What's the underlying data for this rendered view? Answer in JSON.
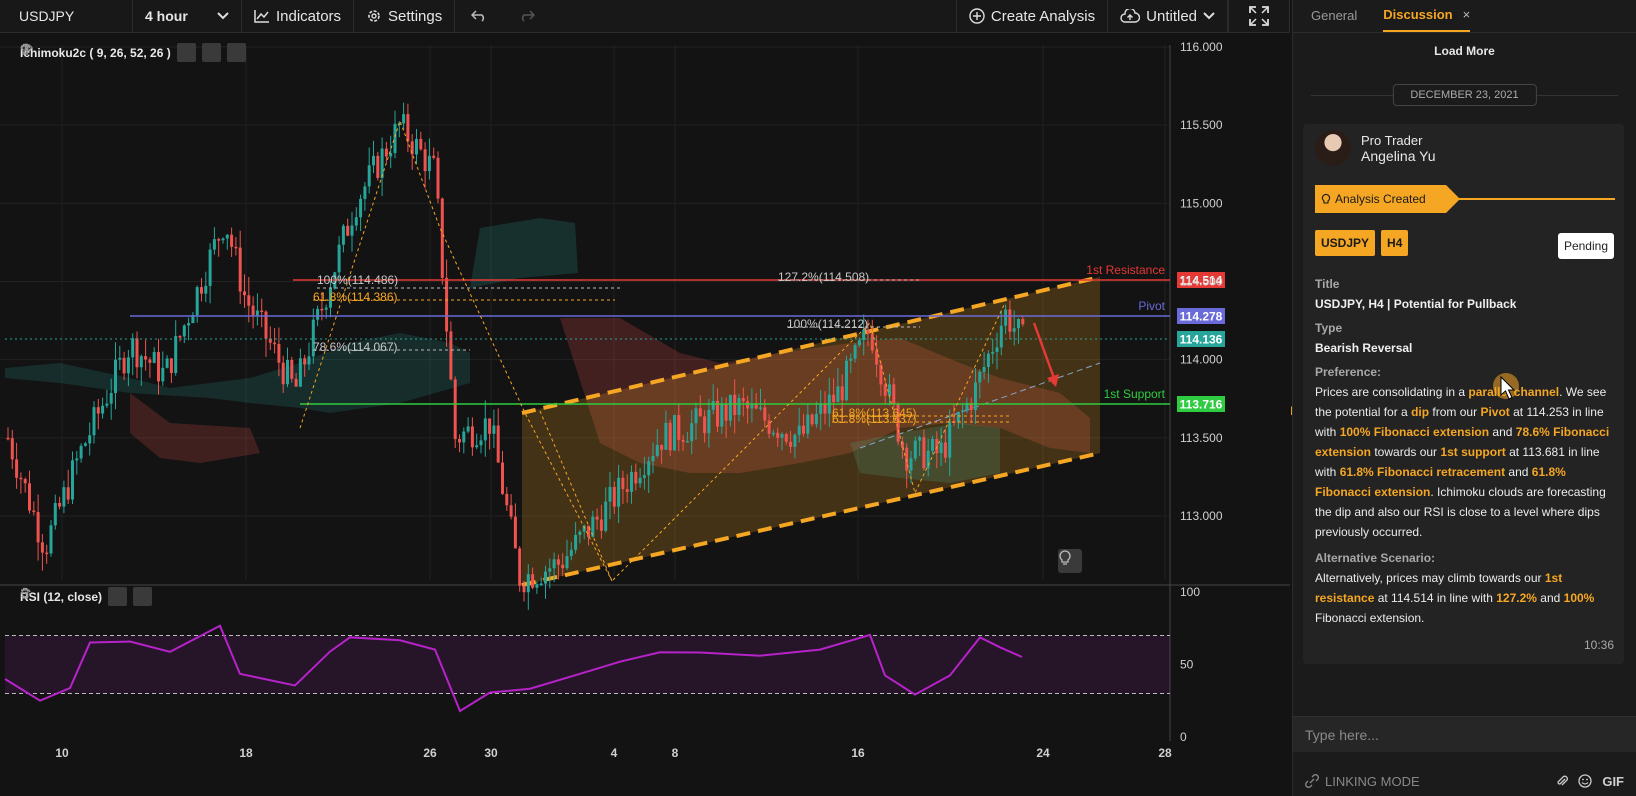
{
  "toolbar": {
    "symbol": "USDJPY",
    "interval": "4 hour",
    "indicators_label": "Indicators",
    "settings_label": "Settings",
    "create_analysis_label": "Create Analysis",
    "layout_name": "Untitled"
  },
  "chart": {
    "indicator_label": "Ichimoku2c ( 9, 26, 52, 26 )",
    "rsi_label": "RSI (12, close)",
    "price_axis": [
      "116.000",
      "115.500",
      "115.000",
      "114.500",
      "114.000",
      "113.500",
      "113.000"
    ],
    "rsi_axis": [
      "100",
      "50",
      "0"
    ],
    "date_axis": [
      "10",
      "18",
      "26",
      "30",
      "4",
      "8",
      "16",
      "24",
      "28"
    ],
    "levels": [
      {
        "name": "1st Resistance",
        "value": "114.514",
        "color": "#e53935"
      },
      {
        "name": "Pivot",
        "value": "114.278",
        "color": "#6a6ad8"
      },
      {
        "name": "",
        "value": "114.136",
        "color": "#26a69a"
      },
      {
        "name": "1st Support",
        "value": "113.716",
        "color": "#2ecc40"
      }
    ],
    "fib_labels": [
      "100%(114.486)",
      "61.8%(114.386)",
      "78.6%(114.067)",
      "127.2%(114.508)",
      "100%(114.212)",
      "61.8%(113.645)",
      "61.8%(113.637)"
    ],
    "colors": {
      "up": "#26a69a",
      "down": "#ef5350",
      "channel": "#f5a623",
      "rsi": "#b623c8"
    }
  },
  "panel": {
    "tabs": [
      "General",
      "Discussion"
    ],
    "load_more": "Load More",
    "date": "DECEMBER 23, 2021",
    "author_role": "Pro Trader",
    "author_name": "Angelina Yu",
    "created_label": "Analysis Created",
    "tags": [
      "USDJPY",
      "H4"
    ],
    "status": "Pending",
    "title_label": "Title",
    "title_value": "USDJPY, H4 | Potential for Pullback",
    "type_label": "Type",
    "type_value": "Bearish Reversal",
    "preference_label": "Preference:",
    "preference": {
      "t1": "Prices are consolidating in a ",
      "h1": "parallel channel",
      "t2": ". We see the potential for a ",
      "h2": "dip",
      "t3": " from our ",
      "h3": "Pivot",
      "t4": " at 114.253 in line with ",
      "h4": "100% Fibonacci extension",
      "t5": " and ",
      "h5": "78.6% Fibonacci extension",
      "t6": " towards our ",
      "h6": "1st support",
      "t7": " at 113.681 in line with ",
      "h7": "61.8% Fibonacci retracement",
      "t8": " and ",
      "h8": "61.8% Fibonacci extension",
      "t9": ". Ichimoku clouds are forecasting the dip and also our RSI is close to a level where dips previously occurred."
    },
    "alt_label": "Alternative Scenario:",
    "alternative": {
      "t1": "Alternatively, prices may climb towards our ",
      "h1": "1st resistance",
      "t2": " at 114.514 in line with ",
      "h2": "127.2%",
      "t3": " and ",
      "h3": "100%",
      "t4": " Fibonacci extension."
    },
    "time": "10:36",
    "input_placeholder": "Type here...",
    "linking_mode": "LINKING MODE",
    "gif_label": "GIF"
  }
}
